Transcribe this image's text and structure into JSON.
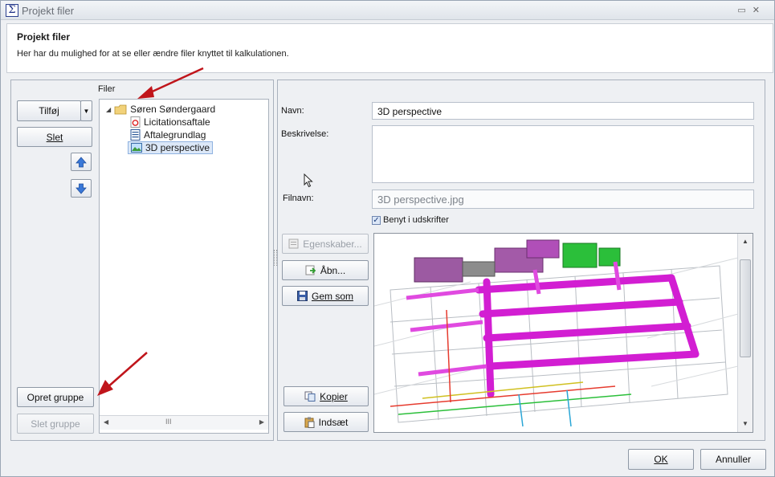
{
  "window": {
    "title": "Projekt filer"
  },
  "header": {
    "title": "Projekt filer",
    "subtitle": "Her har du mulighed for at se eller ændre filer knyttet til kalkulationen."
  },
  "left": {
    "section_label": "Filer",
    "add_button": "Tilføj",
    "delete_button": "Slet",
    "create_group_button": "Opret gruppe",
    "delete_group_button": "Slet gruppe"
  },
  "tree": {
    "root": "Søren Søndergaard",
    "items": [
      {
        "label": "Licitationsaftale",
        "icon": "pdf-icon"
      },
      {
        "label": "Aftalegrundlag",
        "icon": "word-doc-icon"
      },
      {
        "label": "3D perspective",
        "icon": "image-file-icon",
        "selected": true
      }
    ]
  },
  "details": {
    "name_label": "Navn:",
    "name_value": "3D perspective",
    "description_label": "Beskrivelse:",
    "description_value": "",
    "filename_label": "Filnavn:",
    "filename_value": "3D perspective.jpg",
    "use_in_prints_label": "Benyt i udskrifter",
    "use_in_prints_checked": true
  },
  "actions": {
    "properties": "Egenskaber...",
    "open": "Åbn...",
    "save_as": "Gem som",
    "copy": "Kopier",
    "paste": "Indsæt"
  },
  "footer": {
    "ok": "OK",
    "cancel": "Annuller"
  },
  "colors": {
    "accent": "#cc00cc",
    "arrow": "#c0151b",
    "selection": "#dce8f8"
  }
}
